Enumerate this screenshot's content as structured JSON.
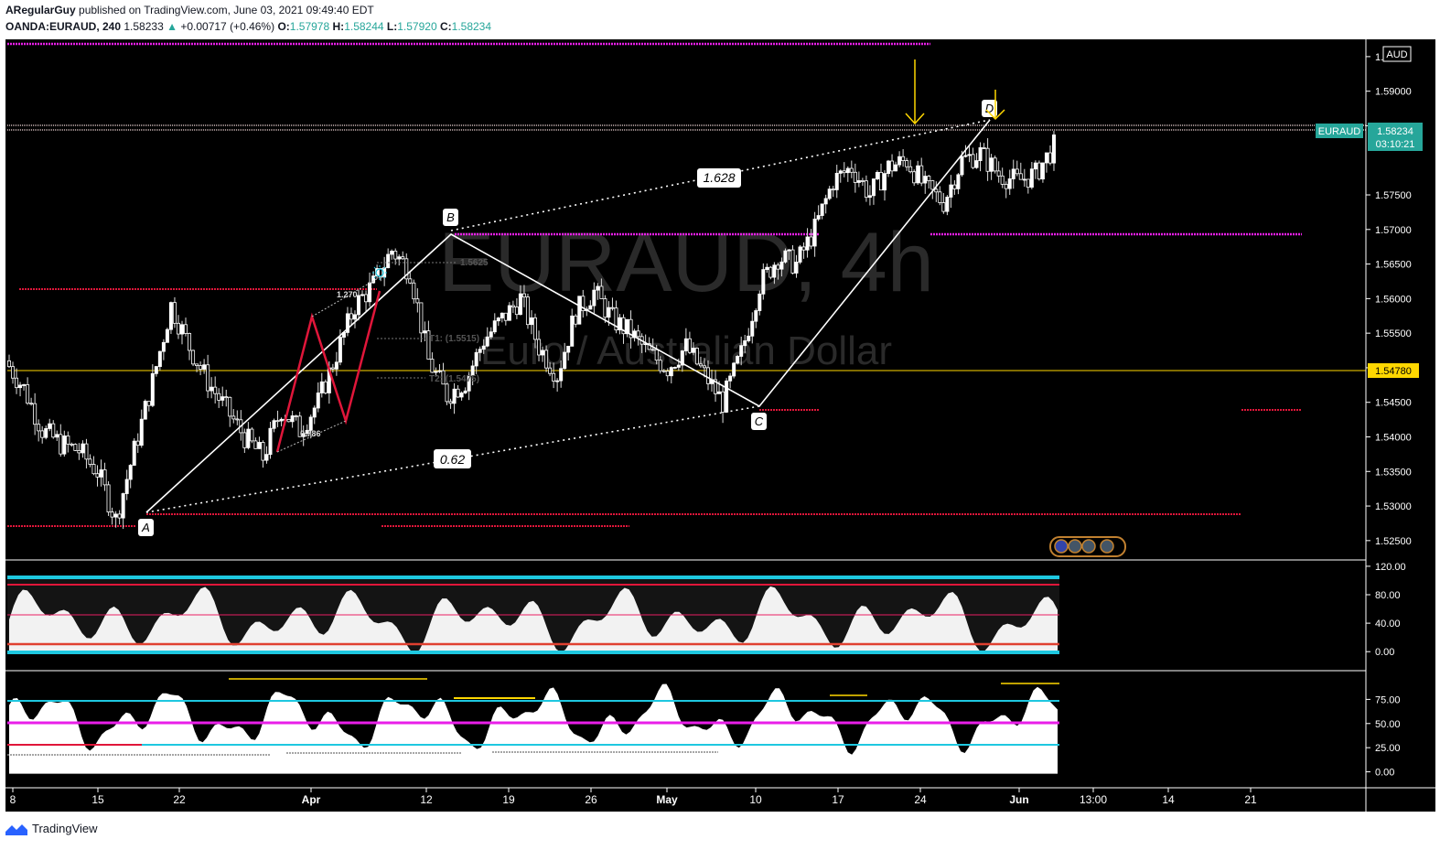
{
  "header": {
    "author": "ARegularGuy",
    "published_text": "published on TradingView.com, June 03, 2021 09:49:40 EDT"
  },
  "ohlc": {
    "symbol": "OANDA:EURAUD, 240",
    "last": "1.58233",
    "change": "+0.00717 (+0.46%)",
    "o_label": "O:",
    "o_value": "1.57978",
    "h_label": "H:",
    "h_value": "1.58244",
    "l_label": "L:",
    "l_value": "1.57920",
    "c_label": "C:",
    "c_value": "1.58234"
  },
  "watermark": {
    "title": "EURAUD, 4h",
    "subtitle": "Euro / Australian Dollar"
  },
  "colors": {
    "background": "#000000",
    "candle_up": "#ffffff",
    "candle_down": "#ffffff",
    "green_badge": "#26a69a",
    "yellow": "#ffd700",
    "magenta": "#e91ee9",
    "red": "#e0163a",
    "cyan": "#1ec8e0"
  },
  "icons": {
    "footer_logo": "tradingview-logo-icon",
    "sun_icon": "sun-marker-icon",
    "arrow": "down-arrow-icon"
  },
  "chart_data": {
    "type": "candlestick",
    "price_axis": {
      "currency_label": "AUD",
      "ticks": [
        "1.59500",
        "1.59000",
        "1.58500",
        "1.57500",
        "1.57000",
        "1.56500",
        "1.56000",
        "1.55500",
        "1.55000",
        "1.54500",
        "1.54000",
        "1.53500",
        "1.53000",
        "1.52500"
      ],
      "tick_values": [
        1.595,
        1.59,
        1.585,
        1.575,
        1.57,
        1.565,
        1.56,
        1.555,
        1.55,
        1.545,
        1.54,
        1.535,
        1.53,
        1.525
      ],
      "ylim": [
        1.5222,
        1.5975
      ]
    },
    "time_axis": {
      "ticks": [
        "8",
        "15",
        "22",
        "Apr",
        "12",
        "19",
        "26",
        "May",
        "10",
        "17",
        "24",
        "Jun",
        "13:00",
        "14",
        "21"
      ]
    },
    "last_price": {
      "symbol_badge": "EURAUD",
      "price": "1.58234",
      "countdown": "03:10:21",
      "value": 1.58234
    },
    "horizontal_level": {
      "label": "1.54780",
      "value": 1.5478
    },
    "harmonic_pattern": {
      "points": [
        {
          "label": "A",
          "price": 1.5275
        },
        {
          "label": "B",
          "price": 1.5675
        },
        {
          "label": "C",
          "price": 1.5425
        },
        {
          "label": "D",
          "price": 1.5842
        }
      ],
      "ratios": [
        {
          "label": "1.628"
        },
        {
          "label": "0.62"
        }
      ]
    },
    "inner_pattern_labels": [
      "1.270",
      "0.786",
      "T1: (1.5515)",
      "T2: (1.5475)",
      "1.5625"
    ],
    "approx_closes": [
      1.551,
      1.547,
      1.541,
      1.539,
      1.538,
      1.535,
      1.528,
      1.538,
      1.548,
      1.559,
      1.553,
      1.548,
      1.544,
      1.54,
      1.537,
      1.544,
      1.541,
      1.545,
      1.552,
      1.559,
      1.562,
      1.567,
      1.564,
      1.551,
      1.546,
      1.548,
      1.554,
      1.557,
      1.56,
      1.553,
      1.549,
      1.558,
      1.561,
      1.557,
      1.555,
      1.552,
      1.55,
      1.553,
      1.549,
      1.545,
      1.552,
      1.562,
      1.566,
      1.565,
      1.57,
      1.577,
      1.579,
      1.575,
      1.579,
      1.58,
      1.576,
      1.574,
      1.58,
      1.581,
      1.578,
      1.577,
      1.578,
      1.582
    ],
    "oscillator_1": {
      "ticks": [
        "120.00",
        "80.00",
        "40.00",
        "0.00"
      ],
      "tick_values": [
        120,
        80,
        40,
        0
      ],
      "ylim": [
        -10,
        125
      ]
    },
    "oscillator_2": {
      "ticks": [
        "75.00",
        "50.00",
        "25.00",
        "0.00"
      ],
      "tick_values": [
        75,
        50,
        25,
        0
      ],
      "ylim": [
        -8,
        100
      ]
    }
  },
  "footer": {
    "brand": "TradingView"
  }
}
